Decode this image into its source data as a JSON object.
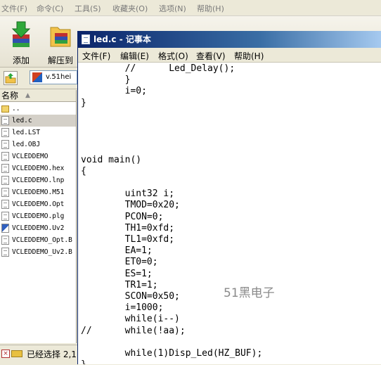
{
  "bg_app": {
    "menu": [
      "文件(F)",
      "命令(C)",
      "工具(S)",
      "收藏夹(O)",
      "选项(N)",
      "帮助(H)"
    ],
    "toolbar": {
      "add_label": "添加",
      "extract_label": "解压到"
    },
    "path": "v.51hei",
    "column_name": "名称",
    "files": [
      {
        "name": "..",
        "type": "folder"
      },
      {
        "name": "led.c",
        "type": "text",
        "selected": true
      },
      {
        "name": "led.LST",
        "type": "text"
      },
      {
        "name": "led.OBJ",
        "type": "text"
      },
      {
        "name": "VCLEDDEMO",
        "type": "text"
      },
      {
        "name": "VCLEDDEMO.hex",
        "type": "text"
      },
      {
        "name": "VCLEDDEMO.lnp",
        "type": "text"
      },
      {
        "name": "VCLEDDEMO.M51",
        "type": "text"
      },
      {
        "name": "VCLEDDEMO.Opt",
        "type": "text"
      },
      {
        "name": "VCLEDDEMO.plg",
        "type": "text"
      },
      {
        "name": "VCLEDDEMO.Uv2",
        "type": "project"
      },
      {
        "name": "VCLEDDEMO_Opt.B",
        "type": "text"
      },
      {
        "name": "VCLEDDEMO_Uv2.B",
        "type": "text"
      }
    ],
    "status_text": "已经选择 2,1"
  },
  "notepad": {
    "title": "led.c - 记事本",
    "menu": [
      "文件(F)",
      "编辑(E)",
      "格式(O)",
      "查看(V)",
      "帮助(H)"
    ],
    "lines": [
      "        //      Led_Delay();",
      "        }",
      "        i=0;",
      "}",
      "",
      "",
      "",
      "",
      "void main()",
      "{",
      "",
      "        uint32 i;",
      "        TMOD=0x20;",
      "        PCON=0;",
      "        TH1=0xfd;",
      "        TL1=0xfd;",
      "        EA=1;",
      "        ET0=0;",
      "        ES=1;",
      "        TR1=1;",
      "        SCON=0x50;",
      "        i=1000;",
      "        while(i--)",
      "//      while(!aa);",
      "",
      "        while(1)Disp_Led(HZ_BUF);",
      "}"
    ]
  },
  "watermark": "51黑电子"
}
